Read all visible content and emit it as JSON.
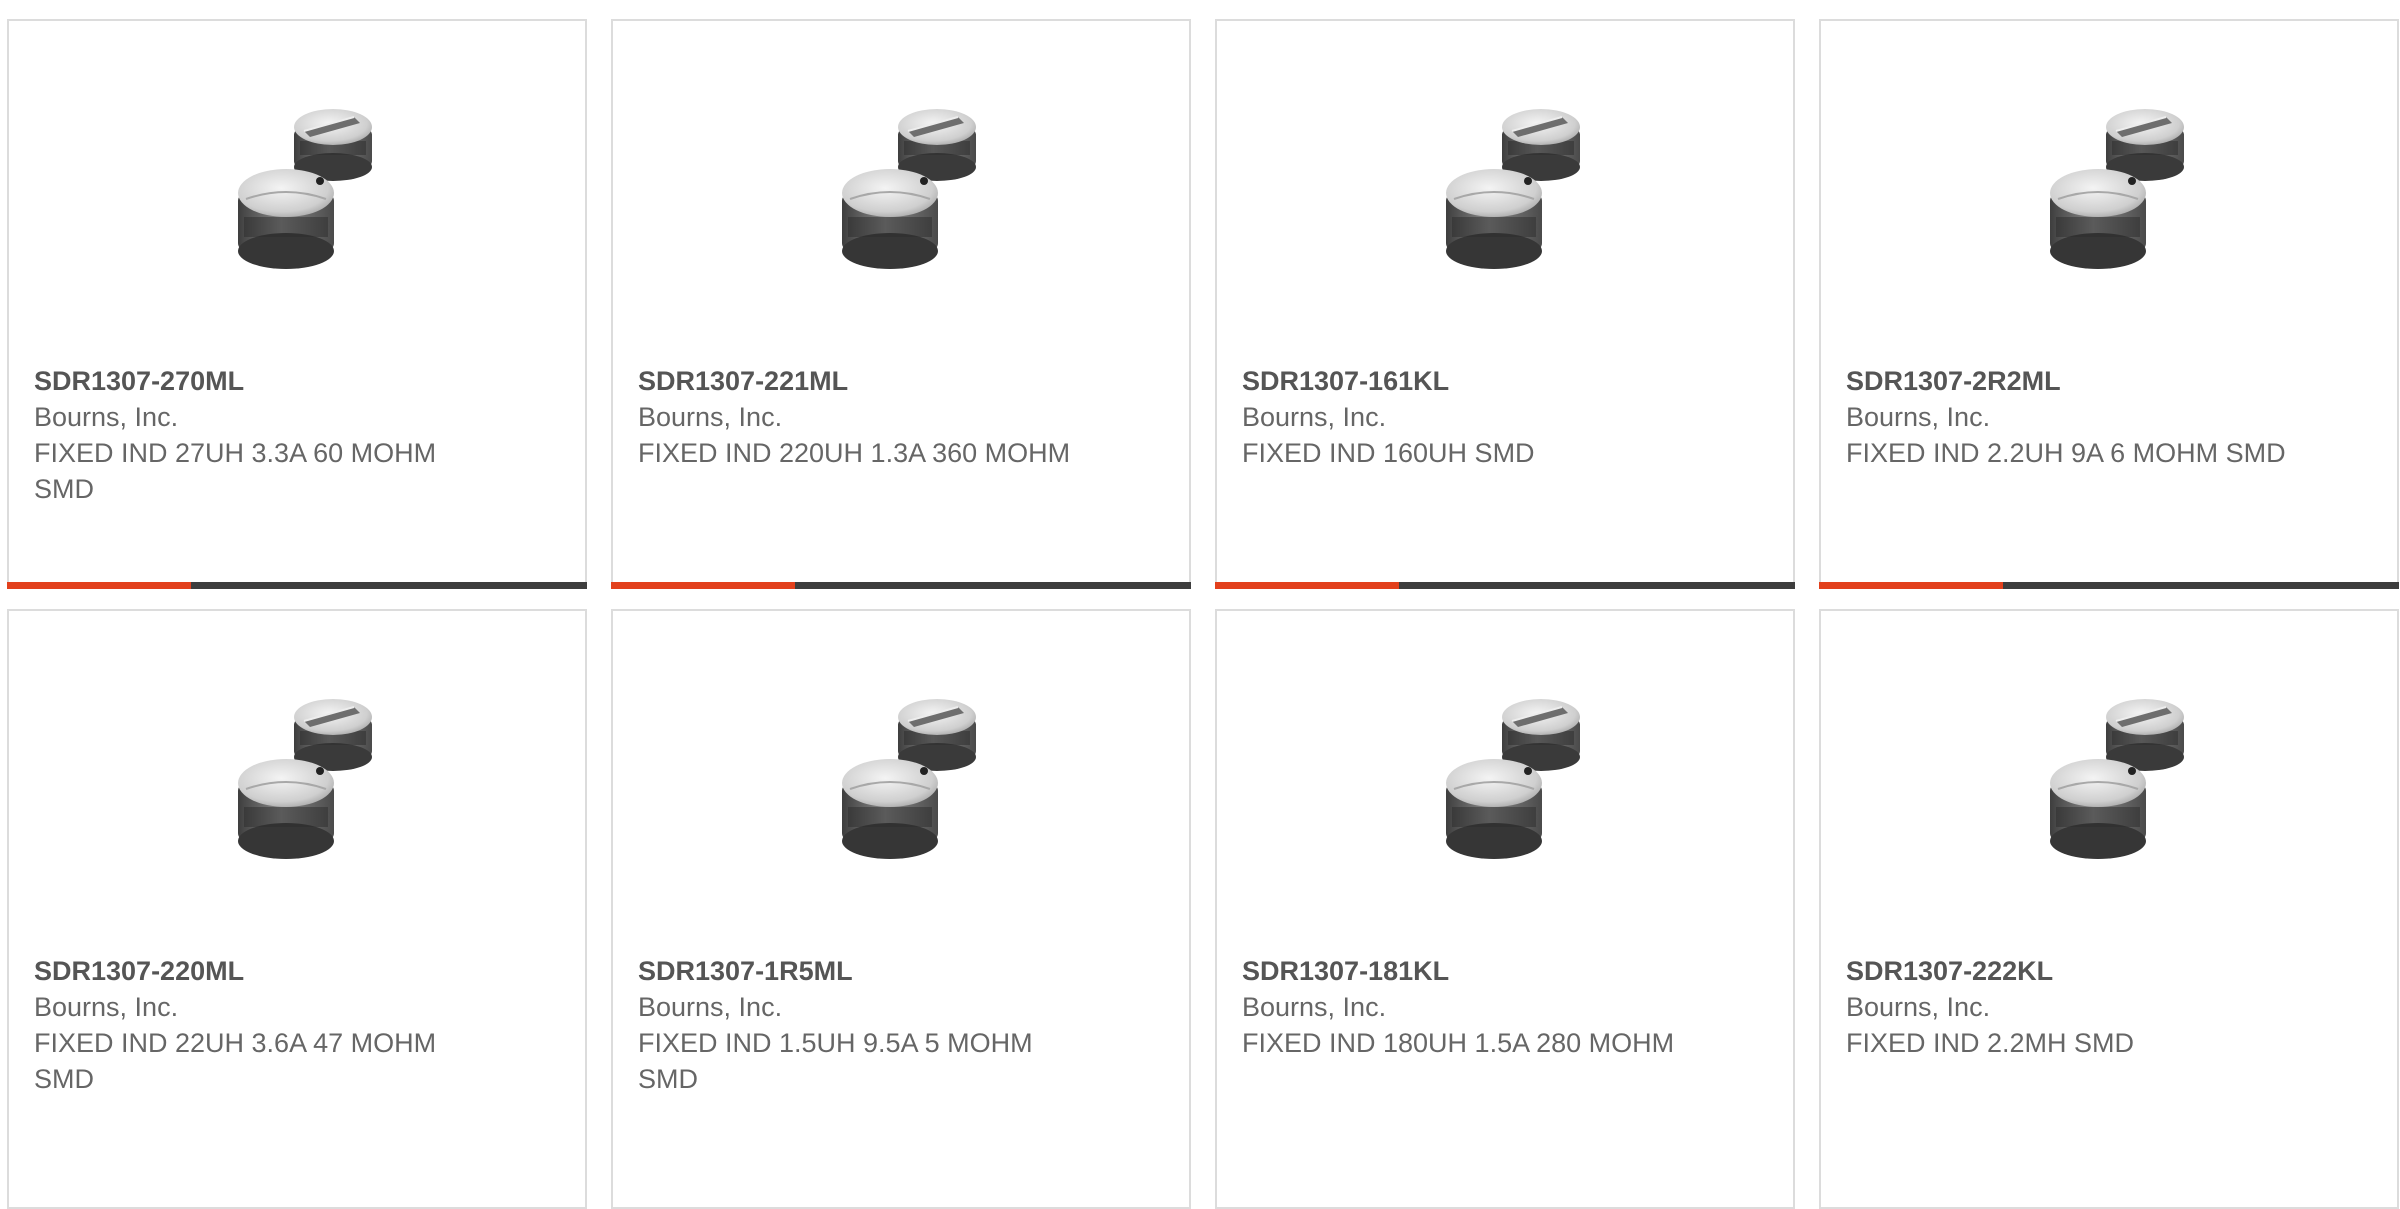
{
  "colors": {
    "accent": "#e2401c",
    "bar": "#3d3d3d",
    "card_border": "#dcdcdc",
    "text": "#666666"
  },
  "products": [
    {
      "part_number": "SDR1307-270ML",
      "manufacturer": "Bourns, Inc.",
      "description": "FIXED IND 27UH 3.3A 60 MOHM SMD",
      "image_icon": "inductor-image"
    },
    {
      "part_number": "SDR1307-221ML",
      "manufacturer": "Bourns, Inc.",
      "description": "FIXED IND 220UH 1.3A 360 MOHM",
      "image_icon": "inductor-image"
    },
    {
      "part_number": "SDR1307-161KL",
      "manufacturer": "Bourns, Inc.",
      "description": "FIXED IND 160UH SMD",
      "image_icon": "inductor-image"
    },
    {
      "part_number": "SDR1307-2R2ML",
      "manufacturer": "Bourns, Inc.",
      "description": "FIXED IND 2.2UH 9A 6 MOHM SMD",
      "image_icon": "inductor-image"
    },
    {
      "part_number": "SDR1307-220ML",
      "manufacturer": "Bourns, Inc.",
      "description": "FIXED IND 22UH 3.6A 47 MOHM SMD",
      "image_icon": "inductor-image"
    },
    {
      "part_number": "SDR1307-1R5ML",
      "manufacturer": "Bourns, Inc.",
      "description": "FIXED IND 1.5UH 9.5A 5 MOHM SMD",
      "image_icon": "inductor-image"
    },
    {
      "part_number": "SDR1307-181KL",
      "manufacturer": "Bourns, Inc.",
      "description": "FIXED IND 180UH 1.5A 280 MOHM",
      "image_icon": "inductor-image"
    },
    {
      "part_number": "SDR1307-222KL",
      "manufacturer": "Bourns, Inc.",
      "description": "FIXED IND 2.2MH SMD",
      "image_icon": "inductor-image"
    }
  ]
}
